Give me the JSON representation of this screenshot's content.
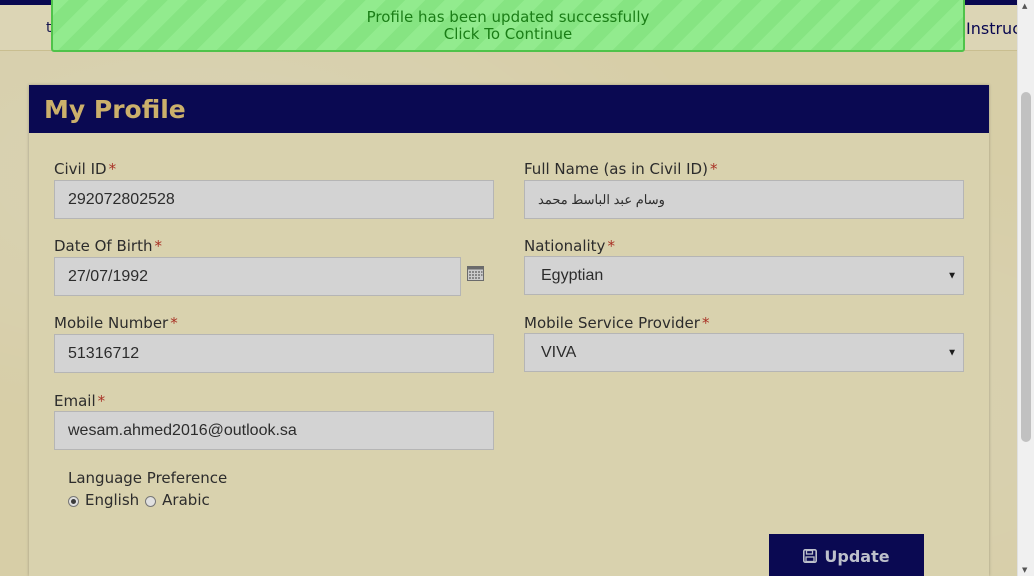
{
  "toast": {
    "message": "Profile has been updated successfully",
    "action": "Click To Continue"
  },
  "nav": {
    "left_fragment": "t",
    "right_fragment": "Instruct"
  },
  "card": {
    "title": "My Profile"
  },
  "form": {
    "civil_id": {
      "label": "Civil ID",
      "value": "292072802528"
    },
    "full_name": {
      "label": "Full Name (as in Civil ID)",
      "value": "وسام عبد الباسط محمد"
    },
    "dob": {
      "label": "Date Of Birth",
      "value": "27/07/1992"
    },
    "nationality": {
      "label": "Nationality",
      "value": "Egyptian"
    },
    "mobile": {
      "label": "Mobile Number",
      "value": "51316712"
    },
    "provider": {
      "label": "Mobile Service Provider",
      "value": "VIVA"
    },
    "email": {
      "label": "Email",
      "value": "wesam.ahmed2016@outlook.sa"
    },
    "required_mark": "*"
  },
  "language": {
    "label": "Language Preference",
    "options": [
      {
        "label": "English",
        "checked": true
      },
      {
        "label": "Arabic",
        "checked": false
      }
    ]
  },
  "buttons": {
    "update_label": "Update",
    "update_icon": "save-icon"
  },
  "colors": {
    "header_bg": "#0c0b5e",
    "title_color": "#e7c97a",
    "toast_bg": "#92eb8e",
    "toast_text": "#1a7d16",
    "required": "#c0392b"
  }
}
